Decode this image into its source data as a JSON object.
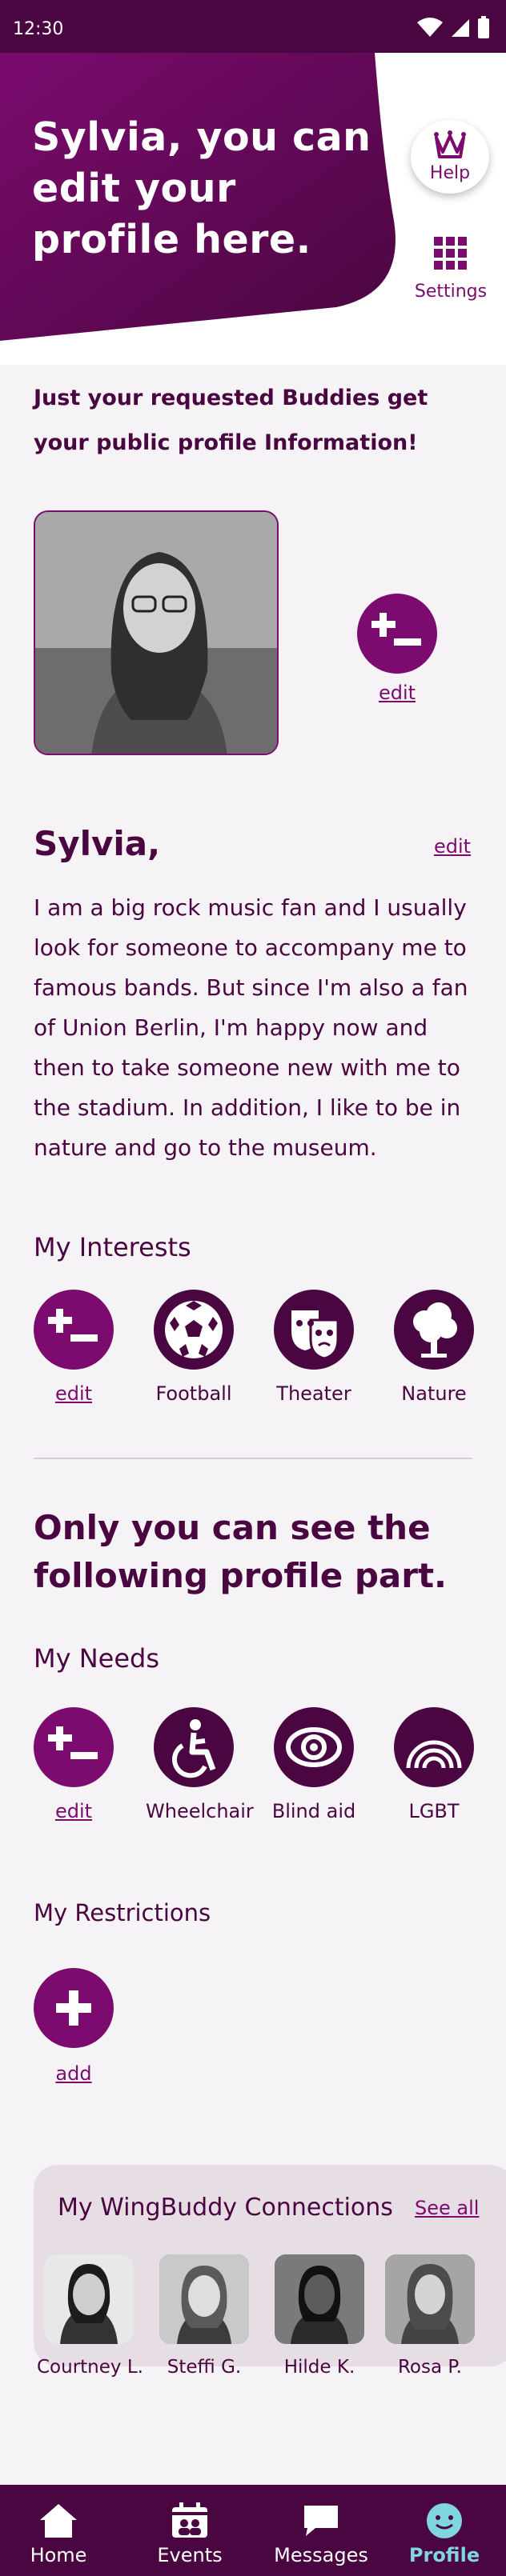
{
  "status_bar": {
    "time": "12:30"
  },
  "header": {
    "headline": "Sylvia, you can edit your profile here.",
    "help_label": "Help",
    "settings_label": "Settings"
  },
  "intro": "Just your requested Buddies get your public profile Information!",
  "photo": {
    "edit_label": "edit"
  },
  "profile": {
    "name": "Sylvia,",
    "edit_label": "edit",
    "bio": "I am a big rock music fan and I usually look for someone to accompany me to famous bands. But since I'm also a fan of Union Berlin, I'm happy now and then to take someone new with me to the stadium. In addition, I like to be in nature and go to the museum."
  },
  "interests": {
    "title": "My Interests",
    "items": [
      {
        "label": "edit",
        "icon": "plus-minus-icon"
      },
      {
        "label": "Football",
        "icon": "football-icon"
      },
      {
        "label": "Theater",
        "icon": "theater-masks-icon"
      },
      {
        "label": "Nature",
        "icon": "tree-icon"
      }
    ]
  },
  "private_title": "Only you can see the following profile part.",
  "needs": {
    "title": "My Needs",
    "items": [
      {
        "label": "edit",
        "icon": "plus-minus-icon"
      },
      {
        "label": "Wheelchair",
        "icon": "wheelchair-icon"
      },
      {
        "label": "Blind aid",
        "icon": "eye-icon"
      },
      {
        "label": "LGBT",
        "icon": "rainbow-icon"
      }
    ]
  },
  "restrictions": {
    "title": "My Restrictions",
    "add_label": "add"
  },
  "connections": {
    "title": "My WingBuddy Connections",
    "see_all": "See all",
    "people": [
      {
        "name": "Courtney L."
      },
      {
        "name": "Steffi G."
      },
      {
        "name": "Hilde K."
      },
      {
        "name": "Rosa P."
      }
    ]
  },
  "nav": {
    "items": [
      {
        "label": "Home",
        "icon": "home-icon"
      },
      {
        "label": "Events",
        "icon": "events-icon"
      },
      {
        "label": "Messages",
        "icon": "messages-icon"
      },
      {
        "label": "Profile",
        "icon": "profile-icon",
        "active": true
      }
    ]
  },
  "colors": {
    "primary": "#7b0b6e",
    "dark": "#4a0640",
    "accent": "#7fd6dd",
    "background": "#f6f3f6"
  }
}
